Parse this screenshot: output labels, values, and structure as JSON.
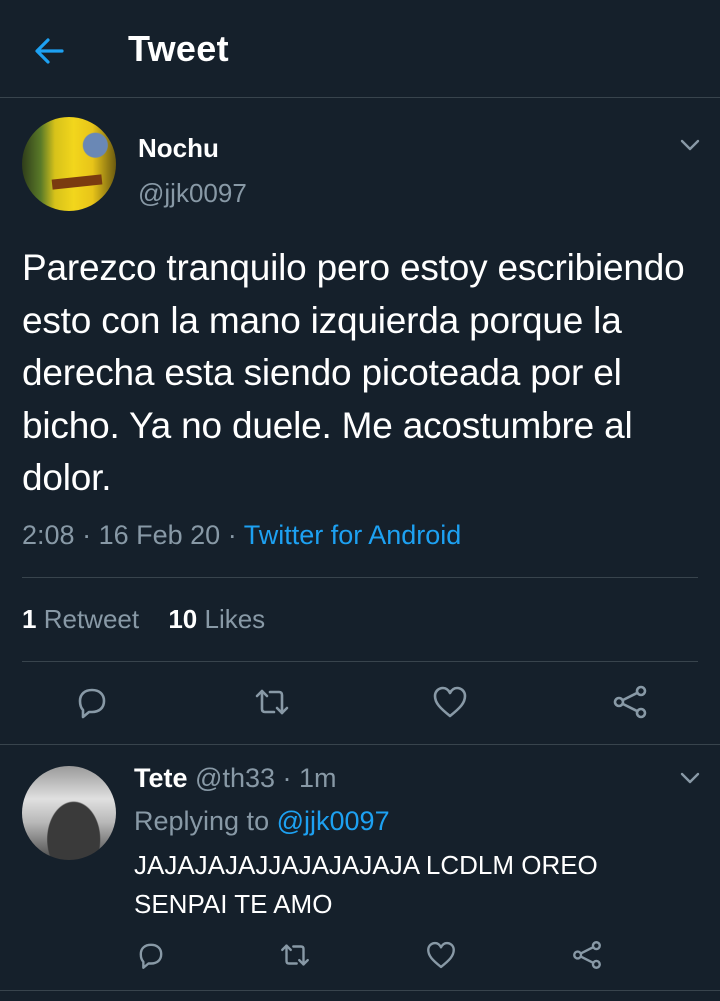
{
  "header": {
    "title": "Tweet",
    "back_icon": "arrow-left-icon"
  },
  "colors": {
    "background": "#15202b",
    "accent": "#1da1f2",
    "muted": "#8899a6",
    "border": "#38444d"
  },
  "tweet": {
    "author_name": "Nochu",
    "author_handle": "@jjk0097",
    "text": "Parezco tranquilo pero estoy escribiendo esto con la mano izquierda porque la derecha esta siendo picoteada por el bicho. Ya no duele. Me acostumbre al dolor.",
    "time": "2:08",
    "date": "16 Feb 20",
    "source": "Twitter for Android",
    "retweets_count": "1",
    "retweets_label": "Retweet",
    "likes_count": "10",
    "likes_label": "Likes"
  },
  "actions": [
    "reply-icon",
    "retweet-icon",
    "like-icon",
    "share-icon"
  ],
  "reply": {
    "author_name": "Tete",
    "author_handle": "@th33",
    "time": "1m",
    "replying_prefix": "Replying to",
    "replying_mention": "@jjk0097",
    "text": "JAJAJAJAJJAJAJAJAJA LCDLM OREO SENPAI TE AMO"
  }
}
